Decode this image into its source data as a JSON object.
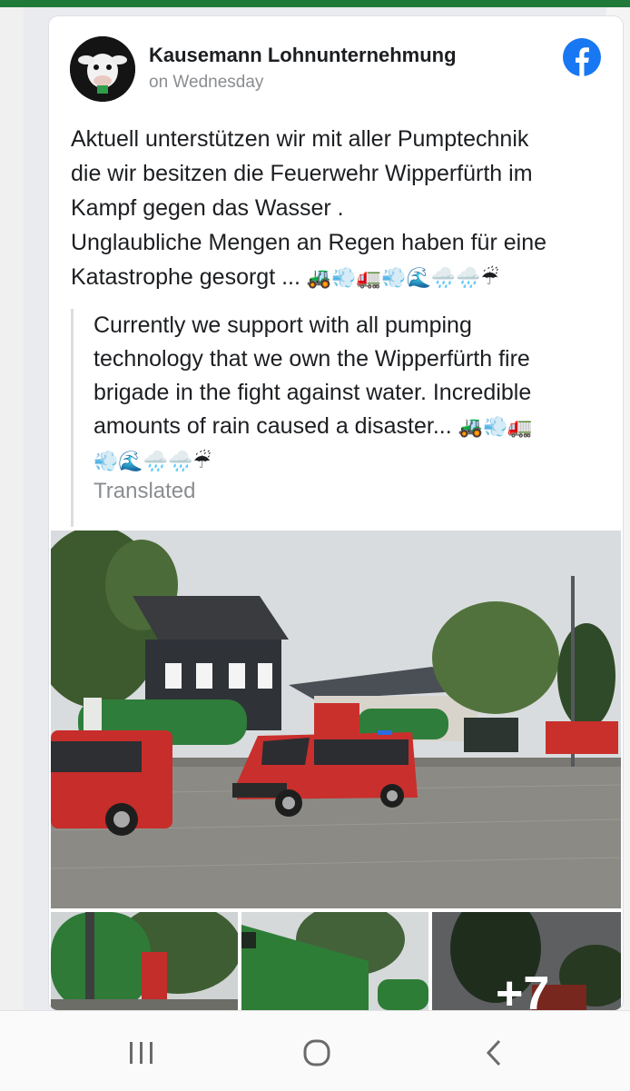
{
  "post": {
    "page_name": "Kausemann Lohnunternehmung",
    "time": "on Wednesday",
    "text_lines": [
      "Aktuell unterstützen wir mit aller Pumptechnik",
      "die wir besitzen die Feuerwehr Wipperfürth im",
      "Kampf gegen das Wasser .",
      "Unglaubliche Mengen an Regen haben für eine",
      "Katastrophe gesorgt ..."
    ],
    "text_emojis": "🚜💨🚛💨🌊🌧️🌧️☔",
    "translation_lines": [
      "Currently we support with all pumping",
      "technology that we own the Wipperfürth fire",
      "brigade in the fight against water. Incredible",
      "amounts of rain caused a disaster..."
    ],
    "translation_emojis_1": "🚜💨🚛",
    "translation_emojis_2": "💨🌊🌧️🌧️☔",
    "translated_label": "Translated",
    "more_photos": "+7"
  },
  "colors": {
    "facebook_blue": "#1877f2",
    "top_strip": "#1f7a3a",
    "secondary_text": "#8a8d91"
  },
  "icons": {
    "facebook": "facebook-logo-icon",
    "recent_apps": "recent-apps-icon",
    "home": "home-icon",
    "back": "back-icon"
  }
}
